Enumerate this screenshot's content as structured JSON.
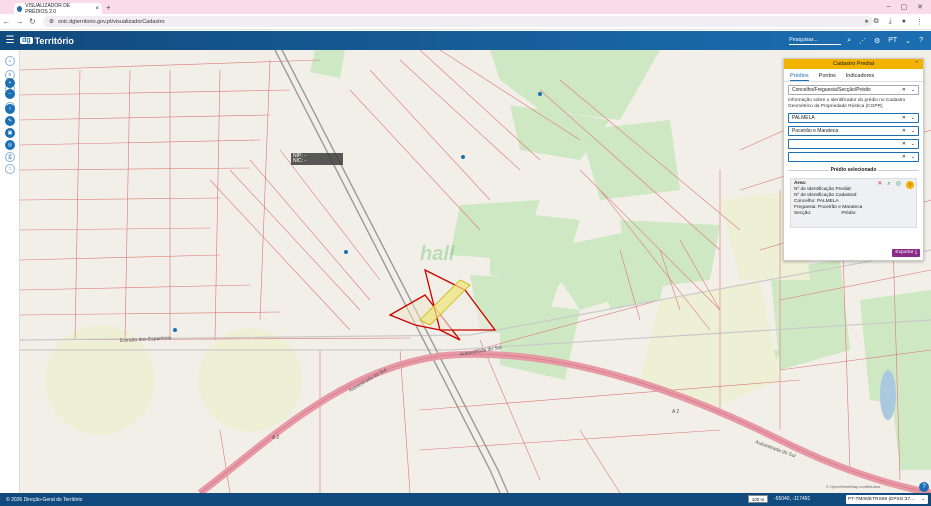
{
  "browser": {
    "tab_title": "VISUALIZADOR DE PRÉDIOS 2.0",
    "url": "snic.dgterritorio.gov.pt/visualizadorCadastro"
  },
  "app": {
    "logo_prefix": "dg",
    "logo_text": "Território",
    "search_placeholder": "Pesquisar...",
    "language": "PT"
  },
  "map": {
    "tooltip_nip": "NIP: -",
    "tooltip_nic": "NIC: -",
    "road_labels": [
      "Autoestrada do Sul",
      "Autoestrada do Sul",
      "Autoestrada do Sul",
      "Estrada dos Espanhóis",
      "A 2",
      "A 2"
    ],
    "watermark": "hall",
    "attribution": "© OpenStreetMap contributors"
  },
  "panel": {
    "title": "Cadastro Predial",
    "tabs": [
      "Prédios",
      "Pontos",
      "Indicadores"
    ],
    "mode_select": "Concelho/Freguesia/Secção/Prédio",
    "info": "Informação sobre o identificador do prédio no Cadastro Geométrico da Propriedade Rústica (CGPR)",
    "concelho": "PALMELA",
    "freguesia": "Poceirão e Marateca",
    "seccao": "",
    "predio": "",
    "selected_header": "Prédio selecionado",
    "details": {
      "area": "Área:",
      "nip": "Nº de Identificação Predial:",
      "nic": "Nº de Identificação Cadastral:",
      "concelho": "Concelho: PALMELA",
      "freguesia": "Freguesia: Poceirão e Marateca",
      "seccao": "Secção:",
      "predio": "Prédio:"
    },
    "export_label": "Exportar"
  },
  "footer": {
    "copyright": "© 2026 Direção-Geral do Território",
    "scale": "100 m",
    "coords": "-55040, -117491",
    "crs": "PT-TM06/ETRS89 (EPSG:37..."
  }
}
